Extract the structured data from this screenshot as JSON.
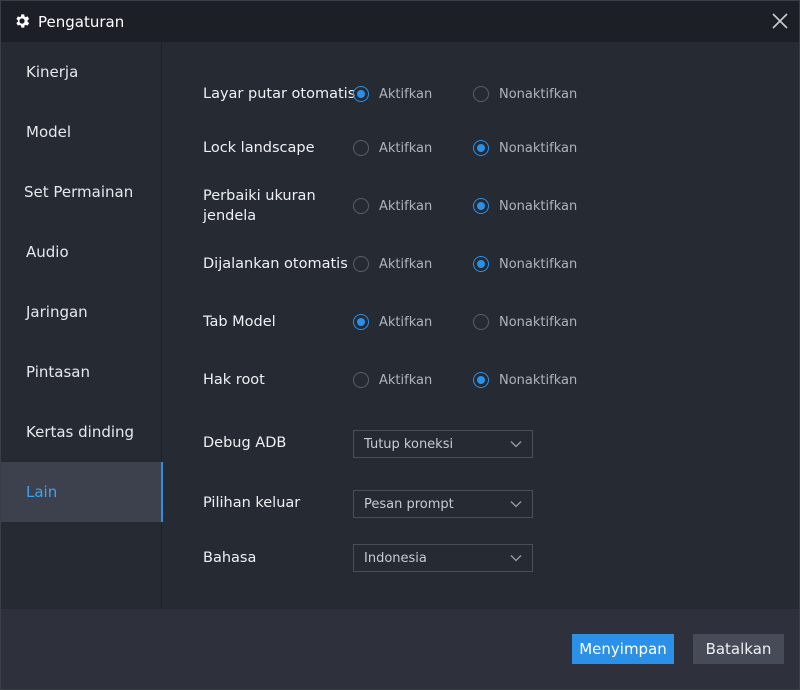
{
  "window": {
    "title": "Pengaturan"
  },
  "sidebar": {
    "items": [
      {
        "label": "Kinerja",
        "active": false
      },
      {
        "label": "Model",
        "active": false
      },
      {
        "label": "Set Permainan",
        "active": false
      },
      {
        "label": "Audio",
        "active": false
      },
      {
        "label": "Jaringan",
        "active": false
      },
      {
        "label": "Pintasan",
        "active": false
      },
      {
        "label": "Kertas dinding",
        "active": false
      },
      {
        "label": "Lain",
        "active": true
      }
    ]
  },
  "settings": {
    "on_label": "Aktifkan",
    "off_label": "Nonaktifkan",
    "rows": [
      {
        "label": "Layar putar otomatis",
        "selected": "on"
      },
      {
        "label": "Lock landscape",
        "selected": "off"
      },
      {
        "label": "Perbaiki ukuran jendela",
        "selected": "off"
      },
      {
        "label": "Dijalankan otomatis",
        "selected": "off"
      },
      {
        "label": "Tab Model",
        "selected": "on"
      },
      {
        "label": "Hak root",
        "selected": "off"
      }
    ],
    "selects": [
      {
        "label": "Debug ADB",
        "value": "Tutup koneksi"
      },
      {
        "label": "Pilihan keluar",
        "value": "Pesan prompt"
      },
      {
        "label": "Bahasa",
        "value": "Indonesia"
      }
    ]
  },
  "footer": {
    "save_label": "Menyimpan",
    "cancel_label": "Batalkan"
  },
  "colors": {
    "accent": "#2b90e8",
    "background": "#262a33",
    "titlebar": "#1c1f26"
  }
}
